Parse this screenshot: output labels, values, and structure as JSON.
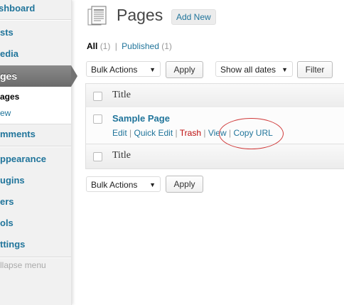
{
  "sidebar": {
    "items": [
      {
        "label": "shboard"
      },
      {
        "label": "sts"
      },
      {
        "label": "edia"
      },
      {
        "label": "ges"
      },
      {
        "label": "mments"
      },
      {
        "label": "ppearance"
      },
      {
        "label": "ugins"
      },
      {
        "label": "ers"
      },
      {
        "label": "ols"
      },
      {
        "label": "ttings"
      }
    ],
    "submenu": {
      "pages": "ages",
      "add_new": "ew"
    },
    "collapse": "llapse menu"
  },
  "header": {
    "title": "Pages",
    "add_new": "Add New"
  },
  "filters": {
    "all_label": "All",
    "all_count": "(1)",
    "separator": "|",
    "published_label": "Published",
    "published_count": "(1)"
  },
  "toolbar": {
    "bulk_actions": "Bulk Actions",
    "apply": "Apply",
    "dates": "Show all dates",
    "filter": "Filter"
  },
  "table": {
    "column_title": "Title",
    "rows": [
      {
        "title": "Sample Page",
        "actions": {
          "edit": "Edit",
          "quick_edit": "Quick Edit",
          "trash": "Trash",
          "view": "View",
          "copy_url": "Copy URL",
          "sep": "|"
        }
      }
    ]
  },
  "colors": {
    "link": "#21759b",
    "trash": "#bc0b0b",
    "annotation": "#d03a3a"
  }
}
